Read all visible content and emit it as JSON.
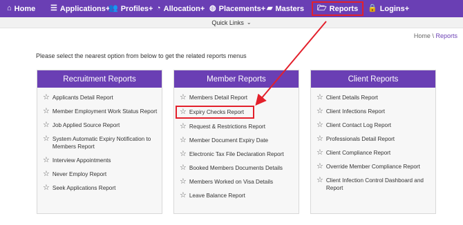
{
  "nav": {
    "home": "Home",
    "applications": "Applications+",
    "profiles": "Profiles+",
    "allocation": "Allocation+",
    "placements": "Placements+",
    "masters": "Masters",
    "reports": "Reports",
    "logins": "Logins+"
  },
  "quick_links": "Quick Links",
  "breadcrumb": {
    "home": "Home",
    "sep": "\\",
    "current": "Reports"
  },
  "intro": "Please select the nearest option from below to get the related reports menus",
  "cards": [
    {
      "title": "Recruitment Reports",
      "items": [
        "Applicants Detail Report",
        "Member Employment Work Status Report",
        "Job Applied Source Report",
        "System Automatic Expiry Notification to Members Report",
        "Interview Appointments",
        "Never Employ Report",
        "Seek Applications Report"
      ]
    },
    {
      "title": "Member Reports",
      "items": [
        "Members Detail Report",
        "Expiry Checks Report",
        "Request & Restrictions Report",
        "Member Document Expiry Date",
        "Electronic Tax File Declaration Report",
        "Booked Members Documents Details",
        "Members Worked on Visa Details",
        "Leave Balance Report"
      ]
    },
    {
      "title": "Client Reports",
      "items": [
        "Client Details Report",
        "Client Infections Report",
        "Client Contact Log Report",
        "Professionals Detail Report",
        "Client Compliance Report",
        "Override Member Compliance Report",
        "Client Infection Control Dashboard and Report"
      ]
    }
  ],
  "colors": {
    "brand": "#6a3fb4",
    "highlight": "#e3202b"
  }
}
